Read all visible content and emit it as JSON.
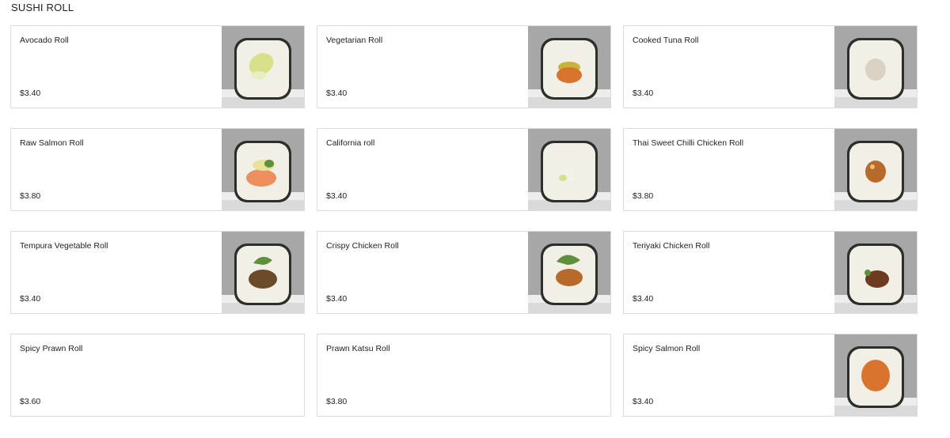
{
  "section": {
    "title": "SUSHI ROLL"
  },
  "items": [
    {
      "name": "Avocado Roll",
      "price": "$3.40",
      "image": "avocado",
      "has_image": true
    },
    {
      "name": "Vegetarian Roll",
      "price": "$3.40",
      "image": "vegetarian",
      "has_image": true
    },
    {
      "name": "Cooked Tuna Roll",
      "price": "$3.40",
      "image": "tuna",
      "has_image": true
    },
    {
      "name": "Raw Salmon Roll",
      "price": "$3.80",
      "image": "salmon",
      "has_image": true
    },
    {
      "name": "California roll",
      "price": "$3.40",
      "image": "california",
      "has_image": true
    },
    {
      "name": "Thai Sweet Chilli Chicken Roll",
      "price": "$3.80",
      "image": "chilli-chicken",
      "has_image": true
    },
    {
      "name": "Tempura Vegetable Roll",
      "price": "$3.40",
      "image": "tempura",
      "has_image": true
    },
    {
      "name": "Crispy Chicken Roll",
      "price": "$3.40",
      "image": "crispy-chicken",
      "has_image": true
    },
    {
      "name": "Teriyaki Chicken Roll",
      "price": "$3.40",
      "image": "teriyaki",
      "has_image": true
    },
    {
      "name": "Spicy Prawn Roll",
      "price": "$3.60",
      "image": "",
      "has_image": false
    },
    {
      "name": "Prawn Katsu Roll",
      "price": "$3.80",
      "image": "",
      "has_image": false
    },
    {
      "name": "Spicy Salmon Roll",
      "price": "$3.40",
      "image": "spicy-salmon",
      "has_image": true
    }
  ],
  "colors": {
    "photo_bg": "#a7a7a7",
    "plate": "#ededed",
    "nori": "#2a2f2a",
    "rice": "#f2efe6",
    "avocado": "#d8e08a",
    "salmon": "#ee8e5c",
    "orange_filling": "#d9742e",
    "chicken": "#b86a2a",
    "greens": "#5f8f3a"
  }
}
